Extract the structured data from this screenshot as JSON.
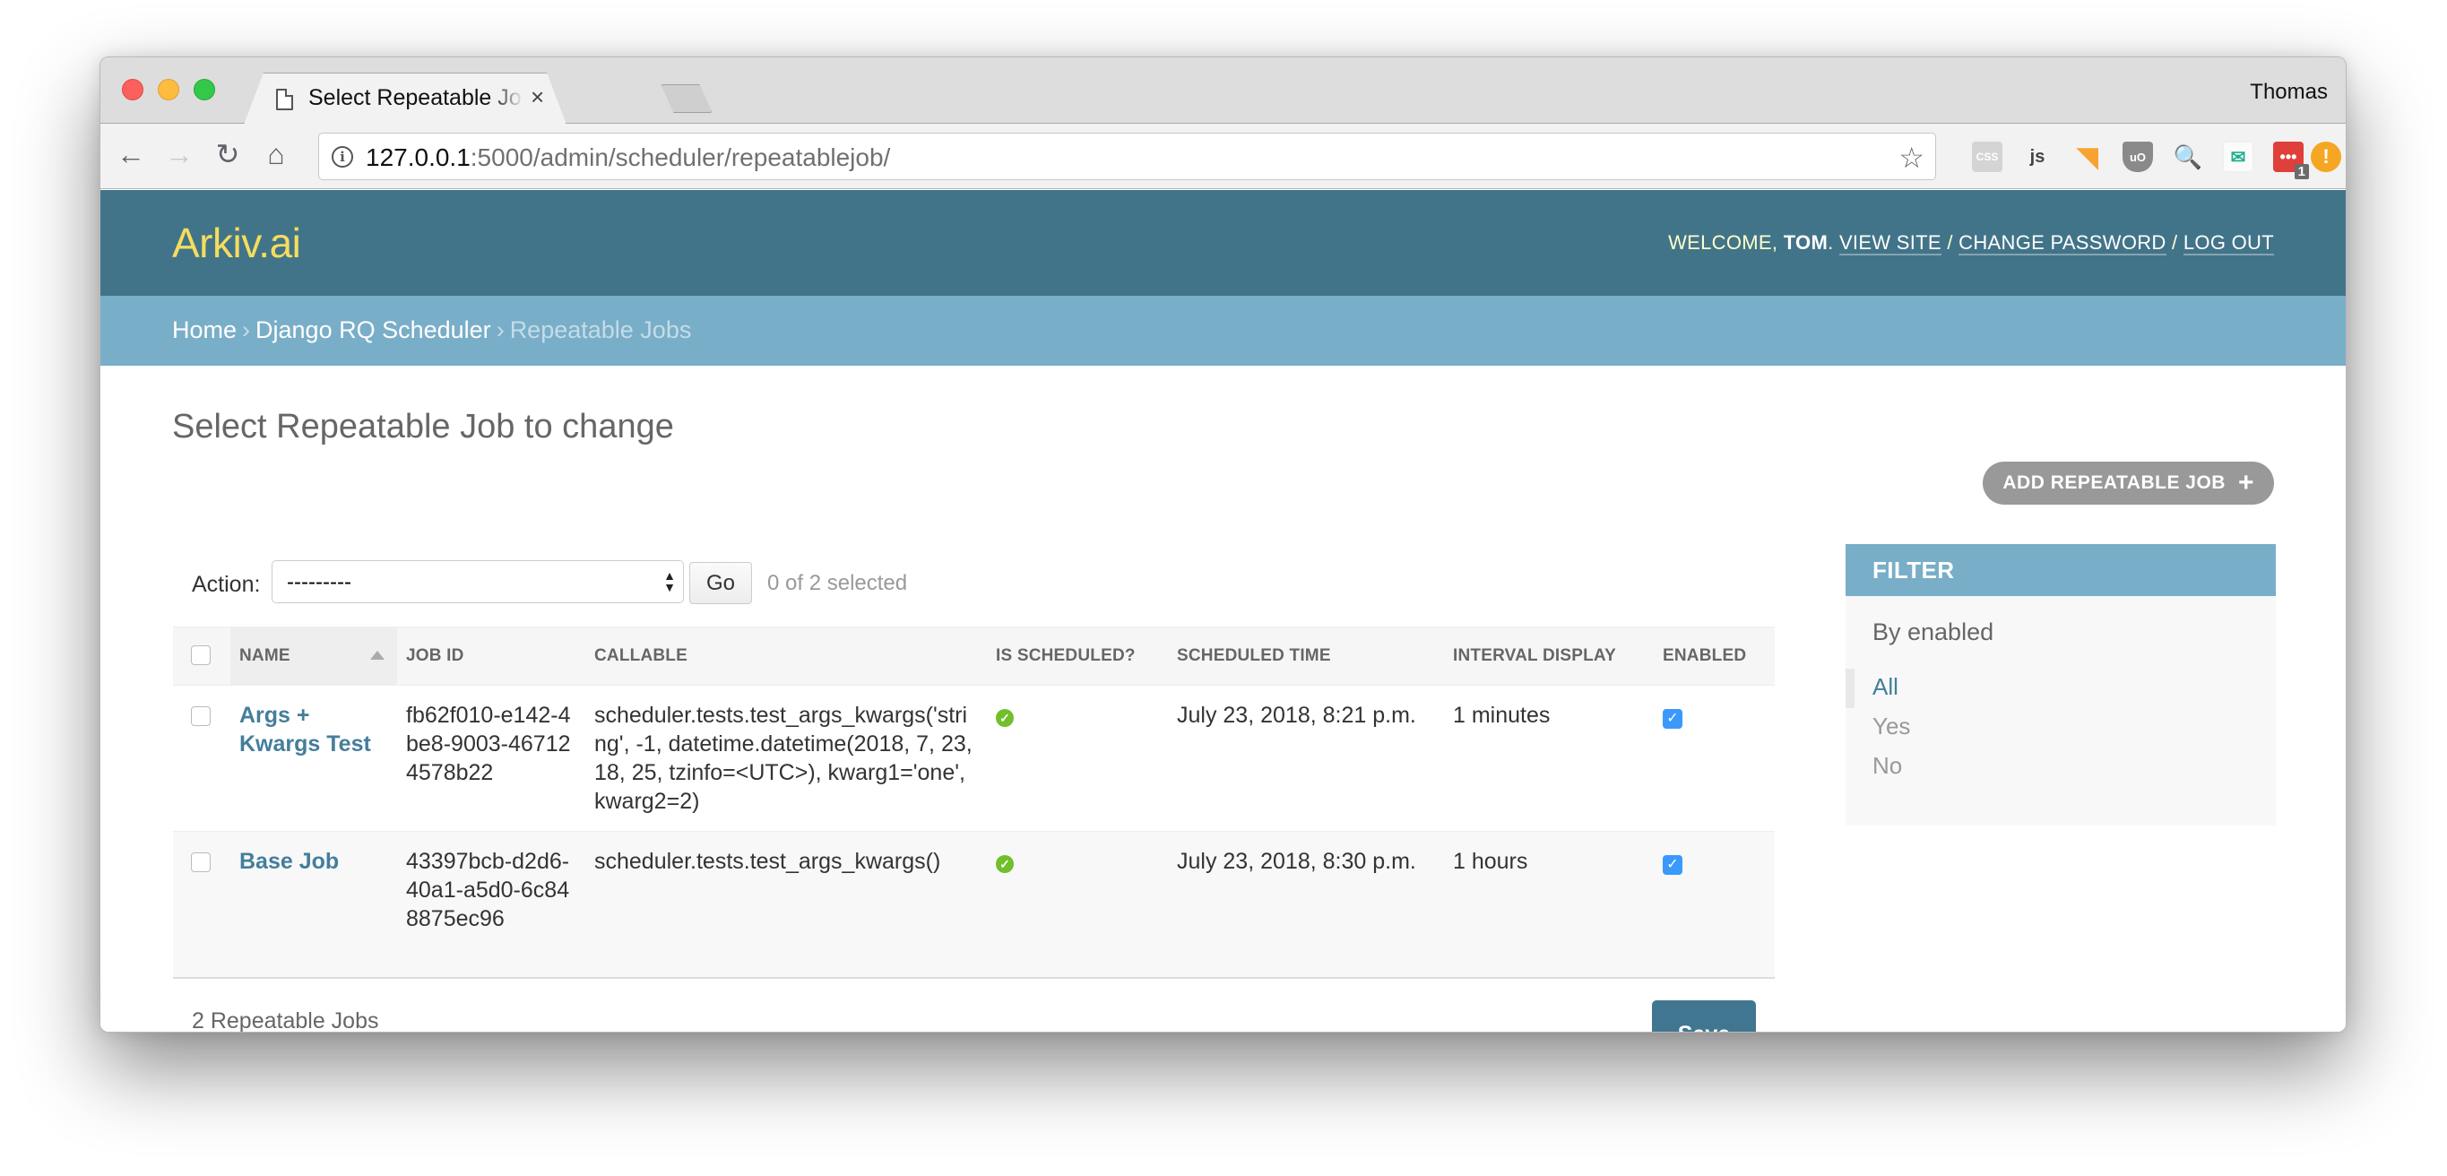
{
  "browser": {
    "tab_title": "Select Repeatable Job to change",
    "tab_close_glyph": "×",
    "profile_name": "Thomas",
    "url_host": "127.0.0.1",
    "url_rest": ":5000/admin/scheduler/repeatablejob/",
    "nav": {
      "back_glyph": "←",
      "forward_glyph": "→",
      "reload_glyph": "↻",
      "home_glyph": "⌂"
    },
    "star_glyph": "☆",
    "info_glyph": "i",
    "extensions": [
      {
        "name": "css-validator-icon",
        "glyph": "CSS"
      },
      {
        "name": "js-icon",
        "glyph": "js"
      },
      {
        "name": "rss-icon",
        "glyph": "◥"
      },
      {
        "name": "ublock-icon",
        "glyph": "uO"
      },
      {
        "name": "lens-icon",
        "glyph": "🔍"
      },
      {
        "name": "tempmail-icon",
        "glyph": "✉"
      },
      {
        "name": "dots-icon",
        "glyph": "•••",
        "badge": "1"
      },
      {
        "name": "alert-icon",
        "glyph": "!"
      }
    ]
  },
  "header": {
    "brand": "Arkiv.ai",
    "welcome_prefix": "WELCOME,",
    "username": "TOM",
    "username_suffix": ".",
    "view_site": "VIEW SITE",
    "change_password": "CHANGE PASSWORD",
    "log_out": "LOG OUT",
    "separator": "/"
  },
  "breadcrumbs": {
    "items": [
      "Home",
      "Django RQ Scheduler"
    ],
    "current": "Repeatable Jobs",
    "separator": "›"
  },
  "content": {
    "title": "Select Repeatable Job to change",
    "add_button": "ADD REPEATABLE JOB",
    "add_icon": "+"
  },
  "actions": {
    "label": "Action:",
    "select_value": "---------",
    "go": "Go",
    "selected_count": "0 of 2 selected"
  },
  "table": {
    "columns": [
      "NAME",
      "JOB ID",
      "CALLABLE",
      "IS SCHEDULED?",
      "SCHEDULED TIME",
      "INTERVAL DISPLAY",
      "ENABLED"
    ],
    "sorted_column": "NAME",
    "sort_direction": "ascending",
    "rows": [
      {
        "name": "Args + Kwargs Test",
        "job_id": "fb62f010-e142-4be8-9003-467124578b22",
        "callable": "scheduler.tests.test_args_kwargs('string', -1, datetime.datetime(2018, 7, 23, 18, 25, tzinfo=<UTC>), kwarg1='one', kwarg2=2)",
        "is_scheduled": true,
        "scheduled_time": "July 23, 2018, 8:21 p.m.",
        "interval_display": "1 minutes",
        "enabled": true,
        "selected": false
      },
      {
        "name": "Base Job",
        "job_id": "43397bcb-d2d6-40a1-a5d0-6c848875ec96",
        "callable": "scheduler.tests.test_args_kwargs()",
        "is_scheduled": true,
        "scheduled_time": "July 23, 2018, 8:30 p.m.",
        "interval_display": "1 hours",
        "enabled": true,
        "selected": false
      }
    ]
  },
  "paginator": "2 Repeatable Jobs",
  "save_button": "Save",
  "filter": {
    "title": "FILTER",
    "by": "By enabled",
    "options": [
      "All",
      "Yes",
      "No"
    ],
    "selected": "All"
  },
  "colors": {
    "header_bg": "#427489",
    "brand": "#f5dd5d",
    "breadcrumbs_bg": "#79aec8",
    "link": "#447e9b",
    "save_bg": "#417690",
    "scheduled_green": "#70bf2b",
    "checkbox_blue": "#3b99fc"
  }
}
